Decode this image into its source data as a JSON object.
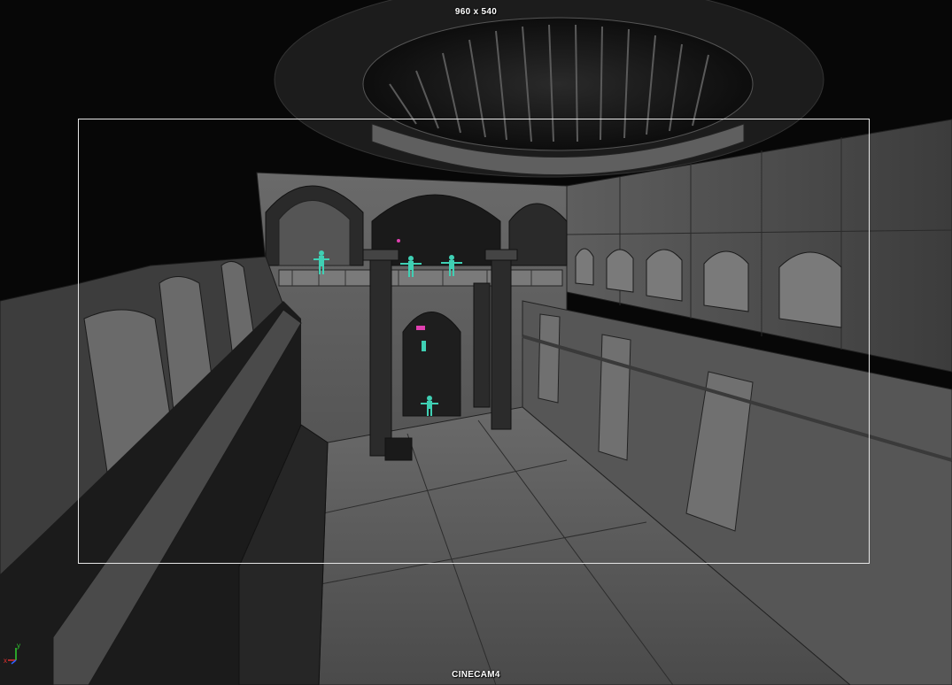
{
  "viewport": {
    "resolution_label": "960 x 540",
    "camera_name": "CINECAM4"
  },
  "axis_gizmo": {
    "x_label": "x",
    "y_label": "y"
  },
  "colors": {
    "background": "#050505",
    "gate_border": "#e6e6e6",
    "character_highlight": "#3fd0b4",
    "selection_highlight": "#e040b0",
    "axis_x": "#e03030",
    "axis_y": "#30d030",
    "axis_z": "#3060ff"
  },
  "icons": {
    "axis": "xyz-axis-icon",
    "character": "character-figure-icon"
  }
}
